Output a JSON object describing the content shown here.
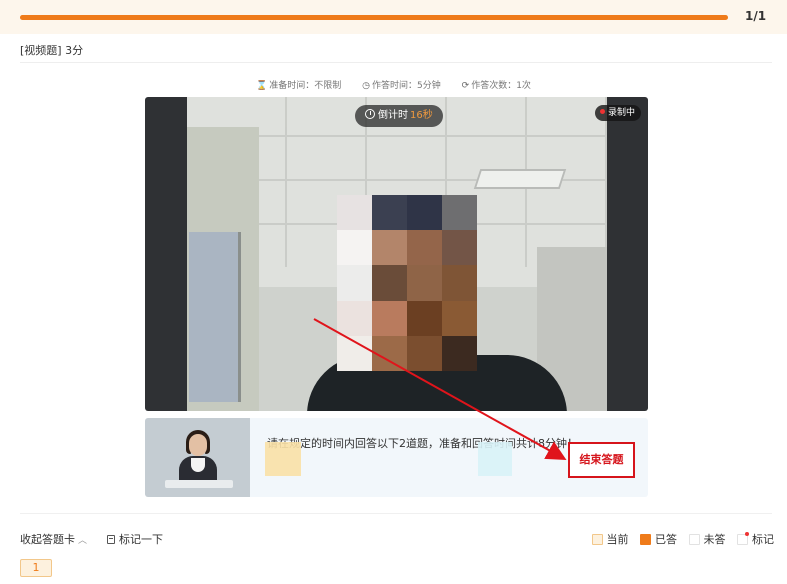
{
  "progress": {
    "label": "1/1",
    "fraction": 1.0,
    "color": "#ef7b1a"
  },
  "question": {
    "type_label": "[视频题] 3分"
  },
  "meta": {
    "prep_time": "准备时间：不限制",
    "answer_time": "作答时间：5分钟",
    "attempts": "作答次数：1次",
    "icons": [
      "hourglass-icon",
      "clock-icon",
      "refresh-icon"
    ]
  },
  "video": {
    "countdown_label": "倒计时",
    "countdown_value": "16秒",
    "recording_label": "录制中",
    "recording_color": "#e33333"
  },
  "prompt": {
    "text": "请在规定的时间内回答以下2道题，准备和回答时间共计8分钟！"
  },
  "actions": {
    "end_answer": "结束答题",
    "end_answer_color": "#d6141b"
  },
  "footer": {
    "collapse_card": "收起答题卡",
    "mark": "标记一下",
    "legend": {
      "current": "当前",
      "answered": "已答",
      "unanswered": "未答",
      "marked": "标记"
    },
    "questions": [
      "1"
    ]
  }
}
